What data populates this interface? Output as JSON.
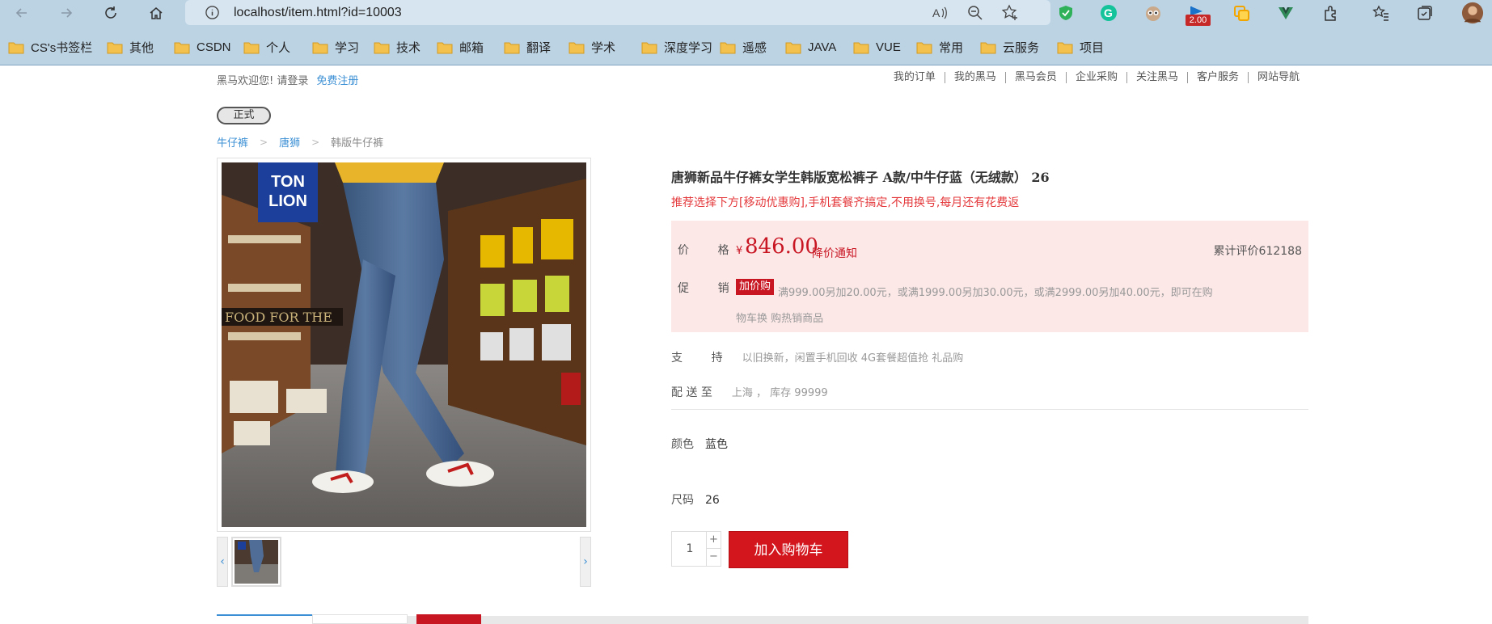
{
  "browser": {
    "url": "localhost/item.html?id=10003",
    "extension_badge": "2.00",
    "bookmarks": [
      "CS's书签栏",
      "其他",
      "CSDN",
      "个人",
      "学习",
      "技术",
      "邮箱",
      "翻译",
      "学术",
      "深度学习",
      "遥感",
      "JAVA",
      "VUE",
      "常用",
      "云服务",
      "项目"
    ]
  },
  "site": {
    "welcome": "黑马欢迎您!  请登录",
    "register": "免费注册",
    "topnav": [
      "我的订单",
      "我的黑马",
      "黑马会员",
      "企业采购",
      "关注黑马",
      "客户服务",
      "网站导航"
    ],
    "env_pill": "正式"
  },
  "breadcrumb": [
    "牛仔裤",
    "唐狮",
    "韩版牛仔裤"
  ],
  "product": {
    "image_logo_line1": "TON",
    "image_logo_line2": "LION",
    "title": "唐狮新品牛仔裤女学生韩版宽松裤子 A款/中牛仔蓝（无绒款） 26",
    "promo": "推荐选择下方[移动优惠购],手机套餐齐搞定,不用换号,每月还有花费返",
    "price_label": "价        格",
    "currency": "¥",
    "price": "846.00",
    "price_notice": "降价通知",
    "reviews": "累计评价612188",
    "promotion_label": "促        销",
    "promotion_tag": "加价购",
    "promotion_text": "满999.00另加20.00元，或满1999.00另加30.00元，或满2999.00另加40.00元，即可在购物车换 购热销商品",
    "support_label": "支        持",
    "support_value": "以旧换新，闲置手机回收 4G套餐超值抢 礼品购",
    "delivery_label": "配 送 至",
    "delivery_value": "上海 ， 库存 99999",
    "color_label": "颜色",
    "color_value": "蓝色",
    "size_label": "尺码",
    "size_value": "26",
    "quantity": "1",
    "qty_plus": "+",
    "qty_minus": "−",
    "add_to_cart": "加入购物车"
  },
  "gallery": {
    "prev": "‹",
    "next": "›"
  },
  "colors": {
    "accent_red": "#c81623",
    "link_blue": "#3b8fd4",
    "chrome_bg": "#bcd3e4"
  }
}
